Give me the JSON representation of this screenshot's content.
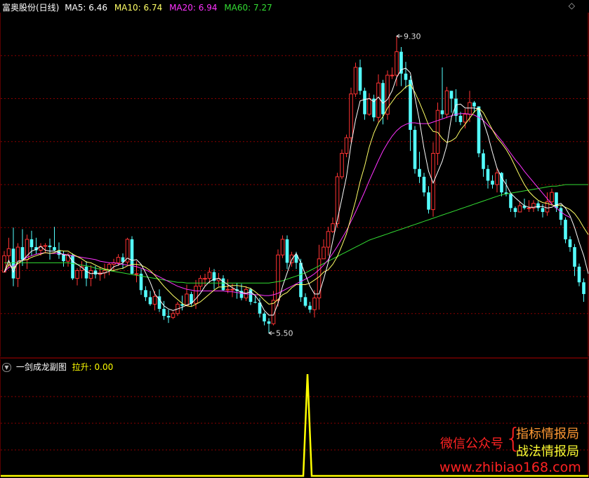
{
  "header": {
    "title": "富奥股份(日线)",
    "ma5": "MA5: 6.46",
    "ma10": "MA10: 6.74",
    "ma20": "MA20: 6.94",
    "ma60": "MA60: 7.27"
  },
  "sub_header": {
    "title": "一剑成龙副图",
    "value": "拉升: 0.00"
  },
  "watermark": {
    "line1": "微信公众号",
    "brace": "{",
    "tag1": "指标情报局",
    "tag2": "战法情报局",
    "url": "www.zhibiao168.com"
  },
  "colors": {
    "up": "#ff3333",
    "down": "#54ffff",
    "ma5": "#ffffff",
    "ma10": "#ffff66",
    "ma20": "#ff33ff",
    "ma60": "#33dd33",
    "signal": "#ffff00",
    "grid": "#8b0000",
    "border": "#b00000"
  },
  "chart_data": {
    "type": "candlestick",
    "price_range": [
      5.2,
      9.6
    ],
    "annotations": [
      {
        "label": "9.30",
        "value": 9.3,
        "at_index": 86
      },
      {
        "label": "5.50",
        "value": 5.5,
        "at_index": 58
      }
    ],
    "candles": [
      [
        6.28,
        6.49,
        6.28,
        6.55
      ],
      [
        6.49,
        6.58,
        6.33,
        6.72
      ],
      [
        6.58,
        6.2,
        6.1,
        6.85
      ],
      [
        6.2,
        6.6,
        6.09,
        6.65
      ],
      [
        6.6,
        6.44,
        6.36,
        6.83
      ],
      [
        6.44,
        6.7,
        6.32,
        6.76
      ],
      [
        6.7,
        6.6,
        6.49,
        6.81
      ],
      [
        6.6,
        6.56,
        6.51,
        6.72
      ],
      [
        6.56,
        6.61,
        6.49,
        6.65
      ],
      [
        6.61,
        6.62,
        6.52,
        6.65
      ],
      [
        6.62,
        6.6,
        6.44,
        6.71
      ],
      [
        6.6,
        6.56,
        6.55,
        6.86
      ],
      [
        6.56,
        6.5,
        6.45,
        6.66
      ],
      [
        6.5,
        6.42,
        6.35,
        6.55
      ],
      [
        6.42,
        6.5,
        6.35,
        6.53
      ],
      [
        6.5,
        6.2,
        6.18,
        6.52
      ],
      [
        6.2,
        6.3,
        6.11,
        6.33
      ],
      [
        6.3,
        6.35,
        6.2,
        6.42
      ],
      [
        6.35,
        6.2,
        6.1,
        6.42
      ],
      [
        6.2,
        6.3,
        6.1,
        6.37
      ],
      [
        6.3,
        6.25,
        6.2,
        6.36
      ],
      [
        6.25,
        6.27,
        6.17,
        6.35
      ],
      [
        6.27,
        6.3,
        6.2,
        6.39
      ],
      [
        6.3,
        6.38,
        6.24,
        6.4
      ],
      [
        6.38,
        6.4,
        6.3,
        6.45
      ],
      [
        6.4,
        6.47,
        6.36,
        6.51
      ],
      [
        6.47,
        6.41,
        6.32,
        6.52
      ],
      [
        6.41,
        6.7,
        6.38,
        6.72
      ],
      [
        6.7,
        6.26,
        6.25,
        6.74
      ],
      [
        6.26,
        6.26,
        6.15,
        6.42
      ],
      [
        6.26,
        6.05,
        5.99,
        6.32
      ],
      [
        6.05,
        5.96,
        5.91,
        6.1
      ],
      [
        5.96,
        5.87,
        5.85,
        6.04
      ],
      [
        5.87,
        5.97,
        5.79,
        6.04
      ],
      [
        5.97,
        5.81,
        5.77,
        6.06
      ],
      [
        5.81,
        5.72,
        5.67,
        5.91
      ],
      [
        5.72,
        5.7,
        5.63,
        5.8
      ],
      [
        5.7,
        5.75,
        5.68,
        5.78
      ],
      [
        5.75,
        5.87,
        5.72,
        5.9
      ],
      [
        5.87,
        5.85,
        5.79,
        5.98
      ],
      [
        5.85,
        6.0,
        5.85,
        6.12
      ],
      [
        6.0,
        5.88,
        5.85,
        6.03
      ],
      [
        5.88,
        6.1,
        5.81,
        6.18
      ],
      [
        6.1,
        6.2,
        6.05,
        6.24
      ],
      [
        6.2,
        6.2,
        6.1,
        6.26
      ],
      [
        6.2,
        6.28,
        6.14,
        6.34
      ],
      [
        6.28,
        6.17,
        6.06,
        6.32
      ],
      [
        6.17,
        6.2,
        6.1,
        6.27
      ],
      [
        6.2,
        6.05,
        6.04,
        6.24
      ],
      [
        6.05,
        6.06,
        6.01,
        6.19
      ],
      [
        6.06,
        6.06,
        5.96,
        6.13
      ],
      [
        6.06,
        6.04,
        5.94,
        6.14
      ],
      [
        6.04,
        5.95,
        5.92,
        6.13
      ],
      [
        5.95,
        6.06,
        5.91,
        6.1
      ],
      [
        6.06,
        5.9,
        5.86,
        6.08
      ],
      [
        5.9,
        5.89,
        5.88,
        5.97
      ],
      [
        5.89,
        5.75,
        5.7,
        5.95
      ],
      [
        5.75,
        5.65,
        5.6,
        5.77
      ],
      [
        5.65,
        5.62,
        5.5,
        5.69
      ],
      [
        5.62,
        5.92,
        5.6,
        6.04
      ],
      [
        5.92,
        6.5,
        5.84,
        6.57
      ],
      [
        6.5,
        6.7,
        6.46,
        6.75
      ],
      [
        6.7,
        6.4,
        6.32,
        6.75
      ],
      [
        6.4,
        6.5,
        6.35,
        6.54
      ],
      [
        6.5,
        6.4,
        6.32,
        6.54
      ],
      [
        6.4,
        5.96,
        5.9,
        6.45
      ],
      [
        5.96,
        5.85,
        5.83,
        6.01
      ],
      [
        5.85,
        5.8,
        5.76,
        5.9
      ],
      [
        5.8,
        5.95,
        5.7,
        6.05
      ],
      [
        5.95,
        6.45,
        5.8,
        6.63
      ],
      [
        6.45,
        6.6,
        6.54,
        6.7
      ],
      [
        6.6,
        6.8,
        6.49,
        6.86
      ],
      [
        6.8,
        6.9,
        6.78,
        6.98
      ],
      [
        6.9,
        7.5,
        6.85,
        7.55
      ],
      [
        7.5,
        7.8,
        7.47,
        7.85
      ],
      [
        7.8,
        8.0,
        7.75,
        8.04
      ],
      [
        8.0,
        8.56,
        7.94,
        8.64
      ],
      [
        8.56,
        8.9,
        8.52,
        8.96
      ],
      [
        8.9,
        8.6,
        8.55,
        9.0
      ],
      [
        8.6,
        8.3,
        8.23,
        8.64
      ],
      [
        8.3,
        8.5,
        8.28,
        8.57
      ],
      [
        8.5,
        8.26,
        8.21,
        8.55
      ],
      [
        8.26,
        8.7,
        8.2,
        8.81
      ],
      [
        8.7,
        8.3,
        8.17,
        8.74
      ],
      [
        8.3,
        8.8,
        8.23,
        8.86
      ],
      [
        8.8,
        8.8,
        8.75,
        8.9
      ],
      [
        8.8,
        9.1,
        8.66,
        9.3
      ],
      [
        9.1,
        8.82,
        8.66,
        9.16
      ],
      [
        8.82,
        8.74,
        8.63,
        8.97
      ],
      [
        8.74,
        8.1,
        7.83,
        8.79
      ],
      [
        8.1,
        7.6,
        7.54,
        8.15
      ],
      [
        7.6,
        7.5,
        7.42,
        7.82
      ],
      [
        7.5,
        7.3,
        7.25,
        7.55
      ],
      [
        7.3,
        7.08,
        7.03,
        7.38
      ],
      [
        7.08,
        7.8,
        6.99,
        7.94
      ],
      [
        7.8,
        8.35,
        7.65,
        8.45
      ],
      [
        8.35,
        8.3,
        8.25,
        8.9
      ],
      [
        8.3,
        8.6,
        8.25,
        8.65
      ],
      [
        8.6,
        8.5,
        8.32,
        8.58
      ],
      [
        8.5,
        8.28,
        8.2,
        8.62
      ],
      [
        8.28,
        8.2,
        8.16,
        8.33
      ],
      [
        8.2,
        8.3,
        8.12,
        8.37
      ],
      [
        8.3,
        8.45,
        8.2,
        8.6
      ],
      [
        8.45,
        8.4,
        8.32,
        8.47
      ],
      [
        8.4,
        7.8,
        7.75,
        8.4
      ],
      [
        7.8,
        7.6,
        7.5,
        7.85
      ],
      [
        7.6,
        7.45,
        7.35,
        7.65
      ],
      [
        7.45,
        7.4,
        7.35,
        7.52
      ],
      [
        7.4,
        7.55,
        7.3,
        7.62
      ],
      [
        7.55,
        7.3,
        7.25,
        7.56
      ],
      [
        7.3,
        7.28,
        7.25,
        7.47
      ],
      [
        7.28,
        7.1,
        7.05,
        7.28
      ],
      [
        7.1,
        7.05,
        6.98,
        7.12
      ],
      [
        7.05,
        7.13,
        7.05,
        7.18
      ],
      [
        7.13,
        7.1,
        7.08,
        7.22
      ],
      [
        7.1,
        7.1,
        7.05,
        7.2
      ],
      [
        7.1,
        7.16,
        7.05,
        7.2
      ],
      [
        7.16,
        7.1,
        7.06,
        7.19
      ],
      [
        7.1,
        7.05,
        6.98,
        7.15
      ],
      [
        7.05,
        7.18,
        7.0,
        7.3
      ],
      [
        7.18,
        7.3,
        7.15,
        7.35
      ],
      [
        7.3,
        7.1,
        7.05,
        7.3
      ],
      [
        7.1,
        6.95,
        6.88,
        7.14
      ],
      [
        6.95,
        6.7,
        6.65,
        6.98
      ],
      [
        6.7,
        6.6,
        6.54,
        6.74
      ],
      [
        6.6,
        6.35,
        6.23,
        6.64
      ],
      [
        6.35,
        6.15,
        6.1,
        6.39
      ],
      [
        6.15,
        6.0,
        5.9,
        6.2
      ]
    ],
    "ma5": [
      6.28,
      6.43,
      6.28,
      6.42,
      6.43,
      6.49,
      6.55,
      6.57,
      6.61,
      6.56,
      6.55,
      6.55,
      6.53,
      6.5,
      6.5,
      6.42,
      6.38,
      6.34,
      6.29,
      6.26,
      6.27,
      6.26,
      6.27,
      6.29,
      6.35,
      6.37,
      6.4,
      6.46,
      6.43,
      6.44,
      6.38,
      6.27,
      6.15,
      6.0,
      5.93,
      5.85,
      5.81,
      5.79,
      5.81,
      5.83,
      5.86,
      5.88,
      5.94,
      6.01,
      6.1,
      6.16,
      6.19,
      6.2,
      6.16,
      6.12,
      6.08,
      6.05,
      6.02,
      6.01,
      6.03,
      5.98,
      5.9,
      5.79,
      5.73,
      5.73,
      5.88,
      6.1,
      6.27,
      6.44,
      6.52,
      6.4,
      6.25,
      6.1,
      6.0,
      6.0,
      6.19,
      6.4,
      6.68,
      6.95,
      7.22,
      7.5,
      7.91,
      8.23,
      8.47,
      8.49,
      8.5,
      8.46,
      8.52,
      8.44,
      8.49,
      8.6,
      8.77,
      8.87,
      8.89,
      8.83,
      8.52,
      8.22,
      7.86,
      7.57,
      7.42,
      7.56,
      7.7,
      7.9,
      8.26,
      8.42,
      8.43,
      8.38,
      8.38,
      8.38,
      8.37,
      8.21,
      8.03,
      7.81,
      7.61,
      7.49,
      7.4,
      7.29,
      7.23,
      7.18,
      7.13,
      7.11,
      7.11,
      7.12,
      7.12,
      7.1,
      7.11,
      7.14,
      7.16,
      7.1,
      7.0,
      6.85,
      6.66,
      6.49,
      6.26
    ],
    "ma10": [
      6.28,
      6.38,
      6.33,
      6.39,
      6.43,
      6.44,
      6.47,
      6.49,
      6.51,
      6.53,
      6.52,
      6.53,
      6.56,
      6.55,
      6.55,
      6.51,
      6.48,
      6.45,
      6.41,
      6.4,
      6.37,
      6.34,
      6.32,
      6.31,
      6.3,
      6.32,
      6.33,
      6.36,
      6.38,
      6.38,
      6.37,
      6.34,
      6.3,
      6.24,
      6.17,
      6.1,
      6.04,
      5.98,
      5.93,
      5.88,
      5.85,
      5.84,
      5.87,
      5.9,
      5.95,
      6.0,
      6.05,
      6.09,
      6.09,
      6.1,
      6.11,
      6.11,
      6.1,
      6.09,
      6.07,
      6.03,
      5.98,
      5.92,
      5.87,
      5.88,
      5.93,
      5.99,
      6.02,
      6.08,
      6.12,
      6.12,
      6.12,
      6.14,
      6.18,
      6.22,
      6.28,
      6.31,
      6.38,
      6.48,
      6.62,
      6.77,
      6.98,
      7.19,
      7.44,
      7.64,
      7.88,
      8.06,
      8.19,
      8.27,
      8.38,
      8.46,
      8.54,
      8.59,
      8.65,
      8.68,
      8.58,
      8.45,
      8.31,
      8.16,
      8.08,
      8.07,
      7.99,
      7.94,
      7.96,
      8.0,
      8.1,
      8.17,
      8.25,
      8.33,
      8.38,
      8.32,
      8.21,
      8.1,
      8.0,
      7.93,
      7.85,
      7.75,
      7.63,
      7.51,
      7.4,
      7.31,
      7.25,
      7.2,
      7.17,
      7.16,
      7.14,
      7.13,
      7.14,
      7.11,
      7.08,
      7.03,
      6.95,
      6.85,
      6.76
    ],
    "ma20": [
      6.28,
      6.34,
      6.36,
      6.39,
      6.43,
      6.47,
      6.49,
      6.51,
      6.52,
      6.53,
      6.52,
      6.52,
      6.52,
      6.51,
      6.5,
      6.49,
      6.48,
      6.47,
      6.46,
      6.45,
      6.44,
      6.42,
      6.41,
      6.4,
      6.4,
      6.39,
      6.38,
      6.37,
      6.36,
      6.35,
      6.33,
      6.31,
      6.28,
      6.25,
      6.22,
      6.19,
      6.16,
      6.13,
      6.1,
      6.08,
      6.06,
      6.05,
      6.04,
      6.04,
      6.04,
      6.04,
      6.04,
      6.04,
      6.04,
      6.03,
      6.03,
      6.02,
      6.01,
      6.0,
      6.0,
      5.99,
      5.99,
      5.98,
      5.98,
      5.99,
      6.01,
      6.04,
      6.07,
      6.1,
      6.13,
      6.16,
      6.19,
      6.22,
      6.26,
      6.31,
      6.37,
      6.44,
      6.52,
      6.61,
      6.71,
      6.81,
      6.93,
      7.05,
      7.18,
      7.31,
      7.45,
      7.58,
      7.71,
      7.83,
      7.93,
      8.02,
      8.09,
      8.14,
      8.17,
      8.19,
      8.19,
      8.18,
      8.18,
      8.18,
      8.2,
      8.22,
      8.24,
      8.26,
      8.28,
      8.3,
      8.31,
      8.31,
      8.3,
      8.29,
      8.26,
      8.22,
      8.16,
      8.1,
      8.03,
      7.96,
      7.88,
      7.8,
      7.72,
      7.65,
      7.57,
      7.5,
      7.43,
      7.36,
      7.29,
      7.22,
      7.15,
      7.1,
      7.05,
      7.01,
      6.98
    ],
    "ma60": [
      6.4,
      6.4,
      6.4,
      6.4,
      6.4,
      6.4,
      6.4,
      6.4,
      6.4,
      6.4,
      6.4,
      6.4,
      6.4,
      6.4,
      6.4,
      6.39,
      6.38,
      6.37,
      6.36,
      6.35,
      6.33,
      6.32,
      6.31,
      6.3,
      6.29,
      6.28,
      6.27,
      6.26,
      6.25,
      6.24,
      6.23,
      6.22,
      6.21,
      6.2,
      6.19,
      6.18,
      6.17,
      6.16,
      6.15,
      6.15,
      6.14,
      6.14,
      6.14,
      6.14,
      6.14,
      6.14,
      6.14,
      6.14,
      6.14,
      6.14,
      6.14,
      6.14,
      6.14,
      6.14,
      6.14,
      6.14,
      6.14,
      6.14,
      6.14,
      6.15,
      6.16,
      6.17,
      6.19,
      6.21,
      6.23,
      6.25,
      6.27,
      6.3,
      6.33,
      6.36,
      6.39,
      6.42,
      6.45,
      6.48,
      6.51,
      6.54,
      6.57,
      6.6,
      6.63,
      6.66,
      6.69,
      6.71,
      6.73,
      6.75,
      6.77,
      6.79,
      6.81,
      6.83,
      6.85,
      6.87,
      6.89,
      6.91,
      6.93,
      6.95,
      6.97,
      6.99,
      7.01,
      7.03,
      7.05,
      7.07,
      7.09,
      7.11,
      7.13,
      7.15,
      7.17,
      7.19,
      7.21,
      7.23,
      7.25,
      7.27,
      7.28,
      7.29,
      7.3,
      7.31,
      7.32,
      7.33,
      7.34,
      7.35,
      7.36,
      7.37,
      7.38,
      7.38,
      7.39,
      7.4,
      7.4,
      7.4,
      7.4,
      7.4
    ],
    "signal": {
      "type": "line",
      "peak_index": 60,
      "peak": 1,
      "base": 0
    }
  }
}
